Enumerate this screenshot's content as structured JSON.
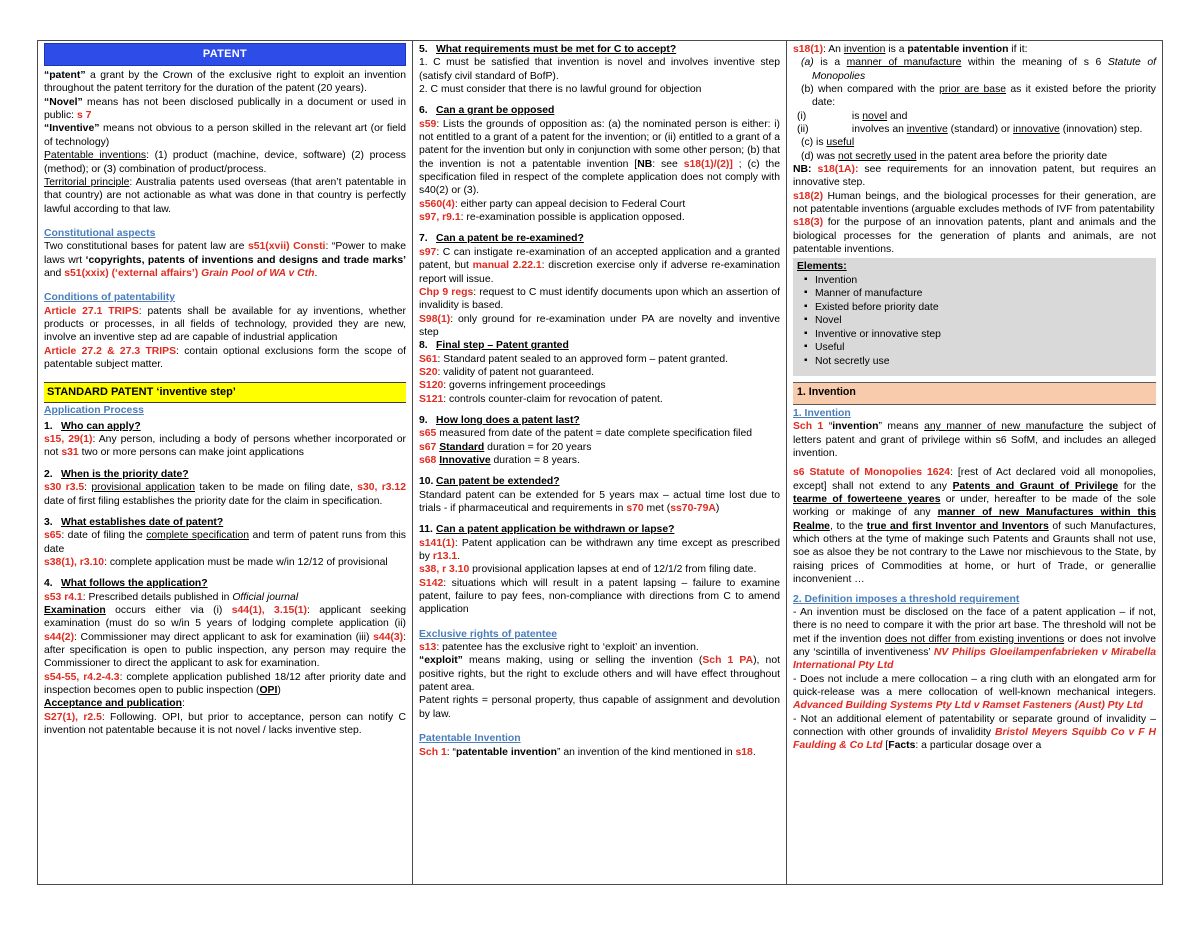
{
  "colors": {
    "banner_blue": "#2E4CE8",
    "banner_yellow": "#FFFF00",
    "banner_peach": "#F8CBAD",
    "box_grey": "#D9D9D9",
    "red": "#E02B20",
    "heading_blue": "#4A7EBB"
  },
  "col1": {
    "banner": "PATENT",
    "def_patent_term": "“patent”",
    "def_patent_body": " a grant by the Crown of the exclusive right to exploit an invention throughout the patent territory for the duration of the patent (20 years).",
    "def_novel_term": "“Novel”",
    "def_novel_body": " means has not been disclosed publically in a document or used in public: ",
    "def_novel_ref": "s 7",
    "def_inventive_term": "“Inventive”",
    "def_inventive_body": " means not obvious to a person skilled in the relevant art (or field of technology)",
    "patentable_label": "Patentable inventions",
    "patentable_body": ": (1) product (machine, device, software) (2) process (method); or (3) combination of product/process.",
    "territorial_label": "Territorial principle",
    "territorial_body": ": Australia patents used overseas (that aren’t patentable in that country) are not actionable as what was done in that country is perfectly lawful according to that law.",
    "constitutional_heading": "Constitutional aspects",
    "const_t1": "Two constitutional bases for patent law are ",
    "const_ref1": "s51(xvii) Consti",
    "const_t2": ": “Power to make laws wrt ",
    "const_quote1": "‘copyrights, patents of inventions and designs and trade marks’",
    "const_t3": " and ",
    "const_ref2": "s51(xxix) (‘external affairs’)",
    "const_case": "Grain Pool of WA v Cth",
    "const_end": ".",
    "conditions_heading": "Conditions of patentability",
    "art271_ref": "Article 27.1 TRIPS",
    "art271_body": ": patents shall be available for ay inventions, whether products or processes, in all fields of technology, provided they are new, involve an inventive step ad are capable of industrial application",
    "art272_ref": "Article 27.2 & 27.3 TRIPS",
    "art272_body": ": contain optional exclusions form the scope of patentable subject matter.",
    "yellow_banner": "STANDARD PATENT ‘inventive step’",
    "app_process_heading": "Application Process",
    "q1_num": "1.",
    "q1_title": "Who can apply?",
    "q1_ref": "s15, 29(1)",
    "q1_body": ": Any person, including a body of persons whether incorporated or not ",
    "q1_ref2": "s31",
    "q1_body2": " two or more persons can make joint applications",
    "q2_num": "2.",
    "q2_title": "When is the priority date?",
    "q2_ref": "s30 r3.5",
    "q2_b1": ": ",
    "q2_u1": "provisional application",
    "q2_b2": " taken to be made on filing date, ",
    "q2_ref2": "s30, r3.12",
    "q2_b3": " date of first filing establishes the priority date for the claim in specification.",
    "q3_num": "3.",
    "q3_title": "What establishes date of patent?",
    "q3_ref": "s65",
    "q3_b1": ": date of filing the ",
    "q3_u1": "complete specification",
    "q3_b2": " and term of patent runs from this date",
    "q3_ref2": "s38(1), r3.10",
    "q3_b3": ": complete application must be made w/in 12/12 of provisional",
    "q4_num": "4.",
    "q4_title": "What follows the application?",
    "q4_ref": "s53 r4.1",
    "q4_b1": ": Prescribed details published in ",
    "q4_ital": "Official journal",
    "q4_exam_label": "Examination",
    "q4_b2": " occurs either via (i) ",
    "q4_ref2": "s44(1), 3.15(1)",
    "q4_b3": ": applicant seeking examination (must do so w/in 5 years of lodging complete application (ii) ",
    "q4_ref3": "s44(2)",
    "q4_b4": ": Commissioner may direct applicant to ask for examination (iii) ",
    "q4_ref4": "s44(3)",
    "q4_b5": ": after specification is open to public inspection, any person may require the Commissioner to direct the applicant to ask for examination.",
    "q4_ref5": "s54-55, r4.2-4.3",
    "q4_b6": ": complete application published 18/12 after priority date and inspection becomes open to public inspection (",
    "q4_opi": "OPI",
    "q4_b7": ")",
    "q4_accept_label": "Acceptance and publication",
    "q4_ref6": "S27(1), r2.5",
    "q4_b8": ": Following. OPI, but prior to acceptance, person can notify C invention not patentable because it is not novel / lacks inventive step."
  },
  "col2": {
    "q5_num": "5.",
    "q5_title": "What requirements must be met for C to accept?",
    "q5_l1": "1. C must be satisfied that invention is novel and involves inventive step (satisfy civil standard of BofP).",
    "q5_l2": "2. C must consider that there is no lawful ground for objection",
    "q6_num": "6.",
    "q6_title": "Can a grant be opposed",
    "q6_ref": "s59",
    "q6_b1": ": Lists the grounds of opposition as: (a) the nominated person is either: i) not entitled to a grant of a patent for the invention; or (ii) entitled to a grant of a patent for the invention but only in conjunction with some other person; (b) that the invention is not a patentable invention [",
    "q6_nb": "NB",
    "q6_b2": ": see ",
    "q6_ref2": "s18(1)/(2)]",
    "q6_b3": " ; (c) the specification filed in respect of the complete application does not comply with s40(2) or (3).",
    "q6_ref3": "s560(4)",
    "q6_b4": ": either party can appeal decision to Federal Court",
    "q6_ref4": "s97, r9.1",
    "q6_b5": ": re-examination possible is application opposed.",
    "q7_num": "7.",
    "q7_title": "Can a patent be re-examined?",
    "q7_ref": "s97",
    "q7_b1": ": C can instigate re-examination of an accepted application and a granted patent, but ",
    "q7_ref2": "manual 2.22.1",
    "q7_b2": ": discretion exercise only if adverse re-examination report will issue.",
    "q7_ref3": "Chp 9 regs",
    "q7_b3": ": request to C must identify documents upon which an assertion of invalidity is based.",
    "q7_ref4": "S98(1)",
    "q7_b4": ": only ground for re-examination under PA are novelty and inventive step",
    "q8_num": "8.",
    "q8_title": "Final step – Patent granted",
    "q8_ref1": "S61",
    "q8_b1": ": Standard patent sealed to an approved form – patent granted.",
    "q8_ref2": "S20",
    "q8_b2": ": validity of patent not guaranteed.",
    "q8_ref3": "S120",
    "q8_b3": ": governs infringement proceedings",
    "q8_ref4": "S121",
    "q8_b4": ": controls counter-claim for revocation of patent.",
    "q9_num": "9.",
    "q9_title": "How long does a patent last?",
    "q9_ref1": "s65",
    "q9_b1": " measured from date of the patent = date complete specification filed",
    "q9_ref2": "s67",
    "q9_u2": "Standard",
    "q9_b2": " duration = for 20 years",
    "q9_ref3": "s68",
    "q9_u3": "Innovative",
    "q9_b3": " duration = 8 years.",
    "q10_num": "10.",
    "q10_title": "Can patent be extended?",
    "q10_b1": "Standard patent can be extended for 5 years max – actual time lost due to trials - if pharmaceutical and requirements in ",
    "q10_ref1": "s70",
    "q10_b2": " met (",
    "q10_ref2": "ss70-79A",
    "q10_b3": ")",
    "q11_num": "11.",
    "q11_title": "Can a patent application be withdrawn or lapse?",
    "q11_ref1": "s141(1)",
    "q11_b1": ": Patent application can be withdrawn any time except as prescribed by ",
    "q11_ref2": "r13.1",
    "q11_b2": ".",
    "q11_ref3": "s38, r 3.10",
    "q11_b3": " provisional application lapses at end of 12/1/2 from filing date.",
    "q11_ref4": "S142",
    "q11_b4": ": situations which will result in a patent lapsing – failure to examine patent, failure to pay fees, non-compliance with directions from C to amend application",
    "excl_heading": "Exclusive rights of patentee",
    "excl_ref1": "s13",
    "excl_b1": ": patentee has the exclusive right to ‘exploit’ an invention.",
    "excl_term": "“exploit”",
    "excl_b2": " means making, using or selling the invention (",
    "excl_ref2": "Sch 1 PA",
    "excl_b3": "), not positive rights, but the right to exclude others and will have effect throughout patent area.",
    "excl_b4": "Patent rights = personal property, thus capable of assignment and devolution by law.",
    "pat_inv_heading": "Patentable Invention",
    "pat_inv_ref": "Sch 1",
    "pat_inv_b1": ": “",
    "pat_inv_term": "patentable invention",
    "pat_inv_b2": "” an invention of the kind mentioned in ",
    "pat_inv_ref2": "s18",
    "pat_inv_b3": "."
  },
  "col3": {
    "s18_ref": "s18(1)",
    "s18_b1": ": An ",
    "s18_u1": "invention",
    "s18_b2": " is a ",
    "s18_bold1": "patentable invention",
    "s18_b3": " if it:",
    "s18_a_label": "(a)",
    "s18_a_t1": " is a ",
    "s18_a_u": "manner of manufacture",
    "s18_a_t2": " within the meaning of s 6 ",
    "s18_a_ital": "Statute of Monopolies",
    "s18_b_label": "(b)",
    "s18_b_t1": " when compared with the ",
    "s18_b_u": "prior are base",
    "s18_b_t2": " as it existed before the priority date:",
    "s18_i_label": "(i)",
    "s18_i_t1": " is ",
    "s18_i_u": "novel",
    "s18_i_t2": " and",
    "s18_ii_label": "(ii)",
    "s18_ii_t1": " involves an ",
    "s18_ii_u1": "inventive",
    "s18_ii_t2": " (standard) or ",
    "s18_ii_u2": "innovative",
    "s18_ii_t3": " (innovation) step.",
    "s18_c_label": "(c)",
    "s18_c_t1": " is ",
    "s18_c_u": "useful",
    "s18_d_label": "(d)",
    "s18_d_t1": " was ",
    "s18_d_u": "not secretly used",
    "s18_d_t2": " in the patent area before the priority date",
    "nb_label": "NB: ",
    "nb_ref": "s18(1A):",
    "nb_body": " see requirements for an innovation patent, but requires an innovative step.",
    "s182_ref": "s18(2)",
    "s182_body": " Human beings, and the biological processes for their generation, are not patentable inventions (arguable excludes methods of IVF from patentability",
    "s183_ref": "s18(3)",
    "s183_body": " for the purpose of an innovation patents, plant and animals and the biological processes for the generation of plants and animals, are not patentable inventions.",
    "elements_title": "Elements:",
    "elements": [
      "Invention",
      "Manner of manufacture",
      "Existed before priority date",
      "Novel",
      "Inventive or innovative step",
      "Useful",
      "Not secretly use"
    ],
    "peach_banner": "1. Invention",
    "inv_heading": "1. Invention",
    "sch1_ref": "Sch 1",
    "sch1_b1": " “",
    "sch1_term": "invention",
    "sch1_b2": "” means ",
    "sch1_u": "any manner of new manufacture",
    "sch1_b3": " the subject of letters patent and grant of privilege within s6 SofM, and includes an alleged invention.",
    "sofm_ref": "s6 Statute of Monopolies 1624",
    "sofm_t1": ": [rest of Act declared void all monopolies, except] shall not extend to any ",
    "sofm_u1": "Patents and Graunt of Privilege",
    "sofm_t2": " for the ",
    "sofm_u2": "tearme of fowerteene yeares",
    "sofm_t3": " or under, hereafter to be made of the sole working or makinge of any ",
    "sofm_u3": "manner of new Manufactures within this Realme",
    "sofm_t4": ", to the ",
    "sofm_u4": "true and first Inventor and Inventors",
    "sofm_t5": " of such Manufactures, which others at the tyme of makinge such Patents and Graunts shall not use, soe as alsoe they be not contrary to the Lawe nor mischievous to the State, by raising prices of Commodities at home, or hurt of Trade, or generallie inconvenient …",
    "def2_heading": "2. Definition imposes a threshold requirement",
    "d1_t1": "- An invention must be disclosed on the face of a patent application – if not, there is no need to compare it with the prior art base. The threshold will not be met if the invention ",
    "d1_u1": "does not differ from existing inventions",
    "d1_t2": " or does not involve any ‘scintilla of inventiveness’ ",
    "d1_case": "NV Philips Gloeilampenfabrieken v Mirabella International Pty Ltd",
    "d2_t1": "- Does not include a mere collocation – a ring cluth with an elongated arm for quick-release was a mere collocation of well-known mechanical integers. ",
    "d2_case": "Advanced Building Systems Pty Ltd v Ramset Fasteners (Aust) Pty Ltd",
    "d3_t1": "- Not an additional element of patentability or separate ground of invalidity – connection with other grounds of invalidity ",
    "d3_case": "Bristol Meyers Squibb Co v F H Faulding & Co Ltd",
    "d3_t2": " [",
    "d3_facts": "Facts",
    "d3_t3": ": a particular dosage over a"
  }
}
